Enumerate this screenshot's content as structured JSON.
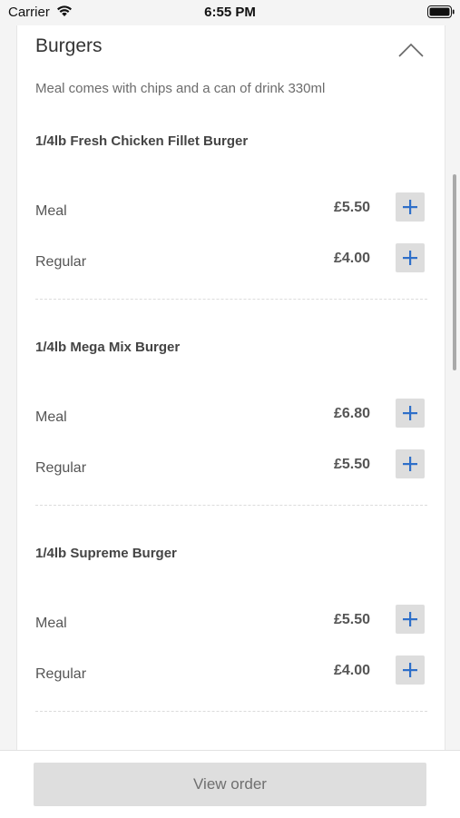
{
  "status_bar": {
    "carrier": "Carrier",
    "time": "6:55 PM"
  },
  "section": {
    "title": "Burgers",
    "description": "Meal comes with chips and a can of drink 330ml",
    "expanded": true
  },
  "items": [
    {
      "name": "1/4lb Fresh Chicken Fillet Burger",
      "options": [
        {
          "label": "Meal",
          "price": "£5.50"
        },
        {
          "label": "Regular",
          "price": "£4.00"
        }
      ]
    },
    {
      "name": "1/4lb Mega Mix Burger",
      "options": [
        {
          "label": "Meal",
          "price": "£6.80"
        },
        {
          "label": "Regular",
          "price": "£5.50"
        }
      ]
    },
    {
      "name": "1/4lb Supreme Burger",
      "options": [
        {
          "label": "Meal",
          "price": "£5.50"
        },
        {
          "label": "Regular",
          "price": "£4.00"
        }
      ]
    }
  ],
  "footer": {
    "view_order_label": "View order"
  },
  "colors": {
    "accent": "#2e6fc9",
    "button_bg": "#dddddd"
  },
  "icons": {
    "wifi": "wifi-icon",
    "battery": "battery-icon",
    "collapse": "chevron-up-icon",
    "add": "plus-icon"
  }
}
